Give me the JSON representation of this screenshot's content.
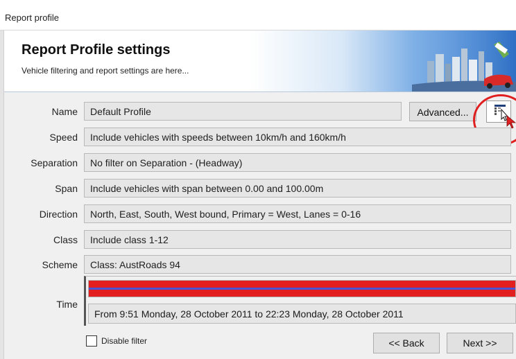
{
  "window": {
    "title": "Report profile"
  },
  "banner": {
    "title": "Report Profile settings",
    "subtitle": "Vehicle filtering and report settings are here..."
  },
  "rows": [
    {
      "label": "Name",
      "value": "Default Profile"
    },
    {
      "label": "Speed",
      "value": "Include vehicles with speeds between 10km/h and 160km/h"
    },
    {
      "label": "Separation",
      "value": "No filter on Separation - (Headway)"
    },
    {
      "label": "Span",
      "value": "Include vehicles with span between 0.00 and 100.00m"
    },
    {
      "label": "Direction",
      "value": "North, East, South, West bound, Primary = West, Lanes = 0-16"
    },
    {
      "label": "Class",
      "value": "Include class 1-12"
    },
    {
      "label": "Scheme",
      "value": "Class: AustRoads 94"
    }
  ],
  "time": {
    "label": "Time",
    "value": "From 9:51 Monday, 28 October 2011 to 22:23 Monday, 28 October 2011",
    "bar_color": "#e31e1e",
    "line_color": "#4a54d6"
  },
  "buttons": {
    "advanced": "Advanced...",
    "back": "<< Back",
    "next": "Next >>"
  },
  "disable_filter": {
    "label": "Disable filter",
    "checked": false
  },
  "icons": {
    "layout_button": "table-settings-icon",
    "cursor": "mouse-pointer-icon"
  },
  "accents": {
    "highlight_circle": "#e02020"
  }
}
